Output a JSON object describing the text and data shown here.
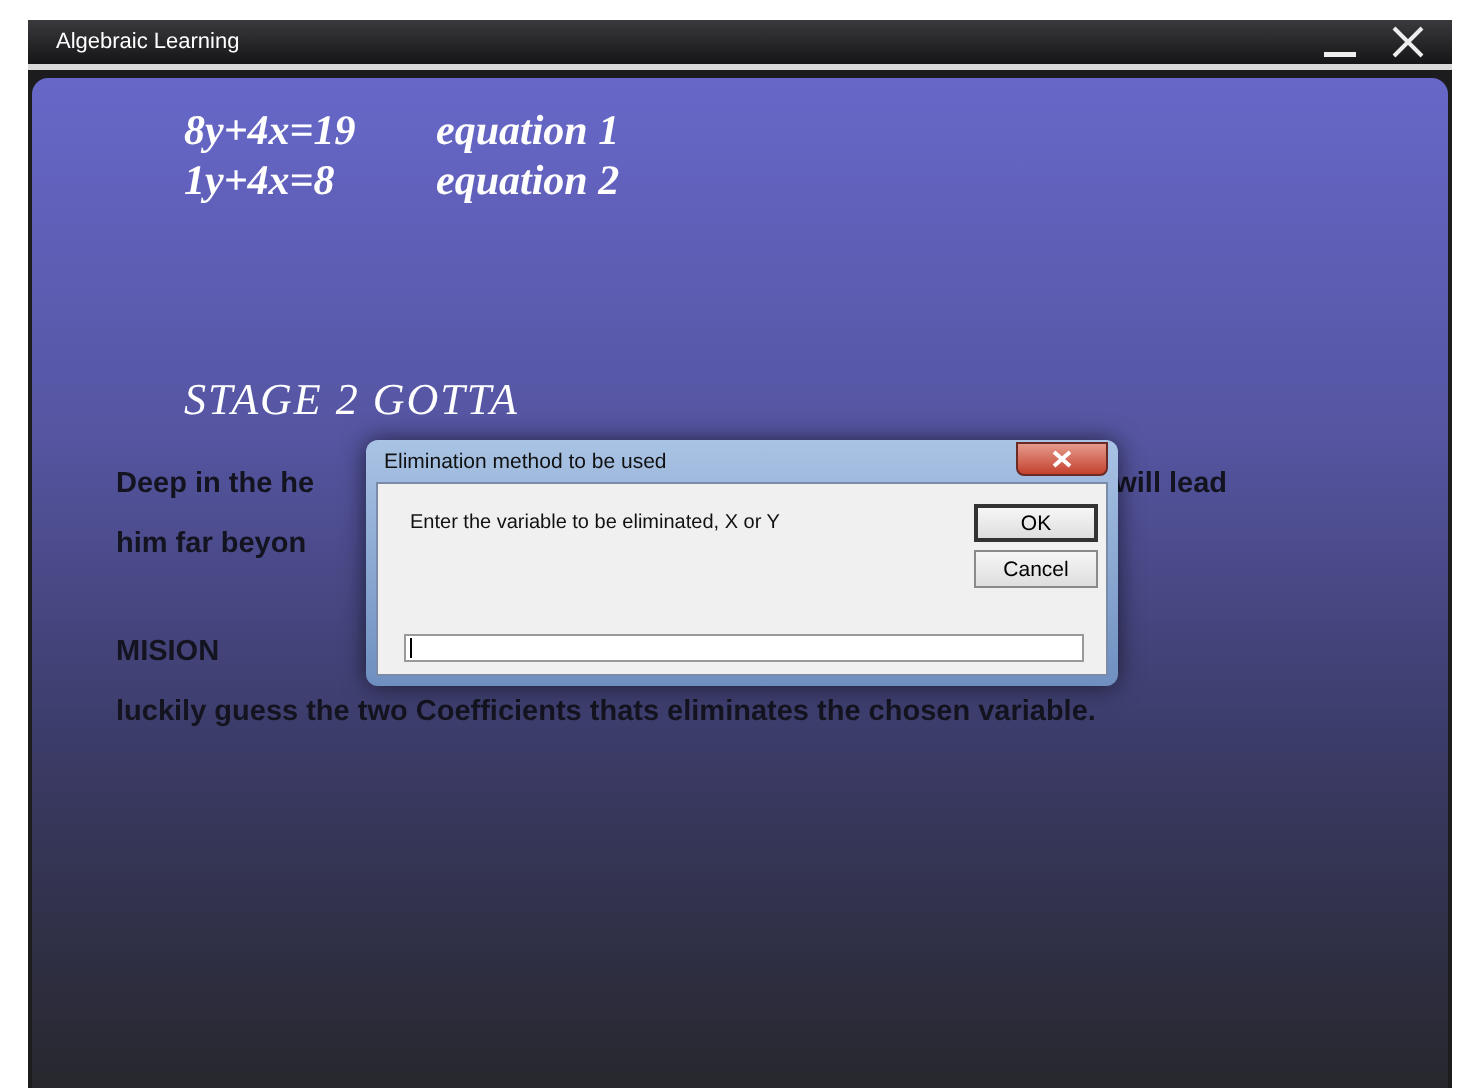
{
  "window": {
    "title": "Algebraic Learning"
  },
  "equations": [
    {
      "formula": "8y+4x=19",
      "label": "equation 1"
    },
    {
      "formula": "1y+4x=8",
      "label": "equation 2"
    }
  ],
  "stage_title": "STAGE 2 GOTTA",
  "story_lines": [
    {
      "left": "Deep in the he",
      "right": "will lead"
    },
    {
      "left": "him far beyon"
    }
  ],
  "mission": {
    "heading": "MISION",
    "text": "luckily guess the two Coefficients thats eliminates the chosen variable."
  },
  "dialog": {
    "title": "Elimination method to be used",
    "message": "Enter the variable to be eliminated, X or Y",
    "buttons": [
      {
        "label": "OK",
        "default": true
      },
      {
        "label": "Cancel",
        "default": false
      }
    ]
  }
}
